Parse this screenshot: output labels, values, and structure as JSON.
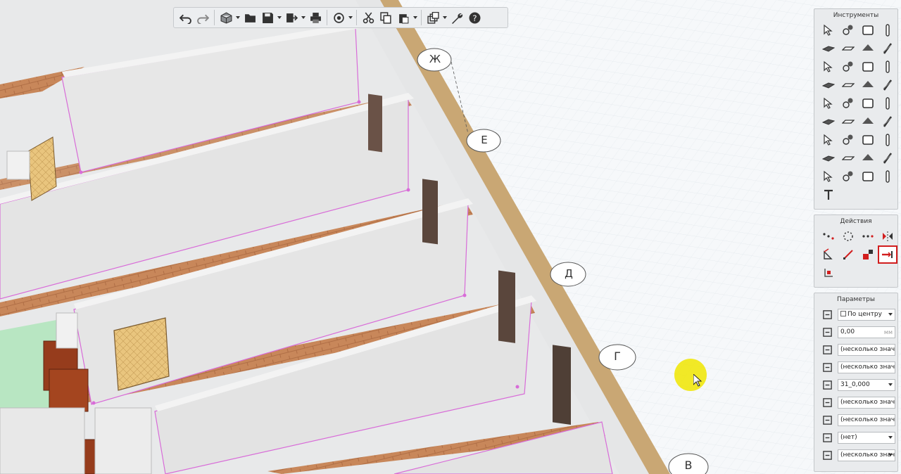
{
  "grid_axes": [
    "Ж",
    "Е",
    "Д",
    "Г",
    "В"
  ],
  "tools_panel": {
    "title": "Инструменты"
  },
  "actions_panel": {
    "title": "Действия"
  },
  "params_panel": {
    "title": "Параметры",
    "rows": [
      {
        "icon": "alignment-icon",
        "value": "По центру",
        "unit": "",
        "dropdown": true,
        "swatch": true
      },
      {
        "icon": "offset-icon",
        "value": "0,00",
        "unit": "мм",
        "dropdown": false,
        "swatch": false
      },
      {
        "icon": "height-icon",
        "value": "(несколько значений)",
        "unit": "",
        "dropdown": false,
        "swatch": false
      },
      {
        "icon": "thickness-icon",
        "value": "(несколько значений)",
        "unit": "",
        "dropdown": false,
        "swatch": false
      },
      {
        "icon": "material-icon",
        "value": "31_0,000",
        "unit": "",
        "dropdown": true,
        "swatch": false
      },
      {
        "icon": "elevation-icon",
        "value": "(несколько значений)",
        "unit": "",
        "dropdown": false,
        "swatch": false
      },
      {
        "icon": "layer-icon",
        "value": "(несколько значений)",
        "unit": "",
        "dropdown": false,
        "swatch": false
      },
      {
        "icon": "hatch-icon",
        "value": "(нет)",
        "unit": "",
        "dropdown": true,
        "swatch": false
      },
      {
        "icon": "style-icon",
        "value": "(несколько значений)",
        "unit": "",
        "dropdown": true,
        "swatch": false
      }
    ]
  },
  "tools": [
    "select-tool",
    "multi-select-tool",
    "slab-tool",
    "column-tool",
    "beam-tool",
    "wall-tool",
    "roof-tool",
    "railing-tool",
    "opening-tool",
    "profile-tool",
    "door-tool",
    "window-tool",
    "stair-tool",
    "line-tool",
    "furniture-tool",
    "niche-tool",
    "plumbing-tool",
    "equipment-tool",
    "lighting-tool",
    "accessory-tool",
    "grid-tool",
    "dimension-tool",
    "level-tool",
    "section-tool",
    "room-tool",
    "area-tool",
    "zone-tool",
    "label-tool",
    "elevation-tool",
    "view-tool",
    "camera-tool",
    "pipe-tool",
    "region-tool",
    "hatch-tool",
    "trim-tool",
    "circle-tool",
    "text-tool"
  ],
  "actions": [
    "move-action",
    "rotate-action",
    "array-action",
    "mirror-action",
    "copy-action",
    "scale-action",
    "delete-action",
    "stretch-action",
    "attach-action"
  ],
  "colors": {
    "wall_outline": "#d86cd8",
    "floor_grid": "#dde4ea",
    "accent_red": "#d21e1e",
    "cursor_highlight": "#f0e600"
  }
}
